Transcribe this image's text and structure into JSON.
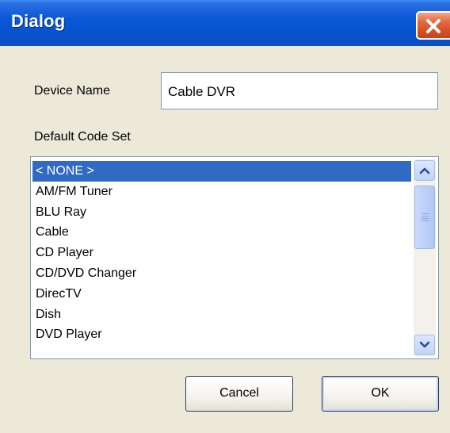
{
  "window": {
    "title": "Dialog"
  },
  "form": {
    "device_name_label": "Device Name",
    "device_name_value": "Cable DVR",
    "code_set_label": "Default Code Set"
  },
  "code_set_list": {
    "items": [
      "< NONE >",
      "AM/FM Tuner",
      "BLU Ray",
      "Cable",
      "CD Player",
      "CD/DVD Changer",
      "DirecTV",
      "Dish",
      "DVD Player"
    ],
    "selected": "< NONE >"
  },
  "buttons": {
    "cancel_label": "Cancel",
    "ok_label": "OK"
  },
  "colors": {
    "selection": "#316ac5",
    "titlebar": "#0a58d8",
    "close_button": "#d84f25",
    "dialog_background": "#ece9d8"
  },
  "icons": {
    "close": "close-icon",
    "scroll_up": "chevron-up-icon",
    "scroll_down": "chevron-down-icon"
  }
}
